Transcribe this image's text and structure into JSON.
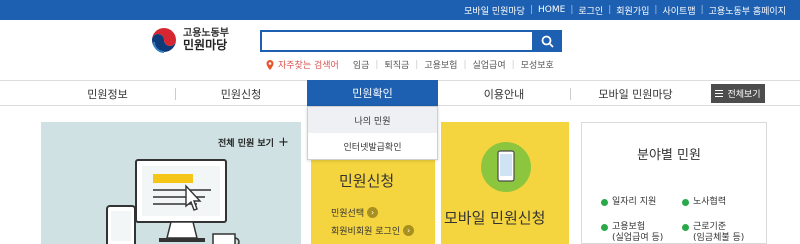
{
  "topbar": {
    "links": [
      "모바일 민원마당",
      "HOME",
      "로그인",
      "회원가입",
      "사이트맵",
      "고용노동부 홈페이지"
    ]
  },
  "logo": {
    "top": "고용노동부",
    "bottom": "민원마당"
  },
  "search": {
    "value": "",
    "placeholder": ""
  },
  "quick": {
    "title": "자주찾는 검색어",
    "items": [
      "임금",
      "퇴직금",
      "고용보험",
      "실업급여",
      "모성보호"
    ]
  },
  "nav": {
    "items": [
      "민원정보",
      "민원신청",
      "민원확인",
      "이용안내",
      "모바일 민원마당"
    ],
    "all_label": "전체보기"
  },
  "dropdown": {
    "items": [
      "나의 민원",
      "인터넷발급확인"
    ]
  },
  "cards": {
    "all_link": "전체 민원 보기",
    "apply_title": "민원신청",
    "apply_links": [
      "민원선택",
      "회원비회원 로그인"
    ],
    "mobile_title": "모바일 민원신청",
    "field_title": "분야별 민원",
    "field_items": [
      {
        "line1": "일자리 지원",
        "line2": ""
      },
      {
        "line1": "노사협력",
        "line2": ""
      },
      {
        "line1": "고용보험",
        "line2": "(실업급여 등)"
      },
      {
        "line1": "근로기준",
        "line2": "(임금체불 등)"
      }
    ]
  },
  "colors": {
    "primary": "#1d5fb0",
    "yellow": "#f5d53f",
    "teal": "#cfe1e3",
    "green": "#2aa84a",
    "dark": "#4d4d4d"
  },
  "icons": [
    "search-icon",
    "location-pin-icon",
    "menu-icon",
    "plus-icon",
    "arrow-right-icon",
    "computer-illustration",
    "smartphone-icon",
    "logo-mark"
  ]
}
